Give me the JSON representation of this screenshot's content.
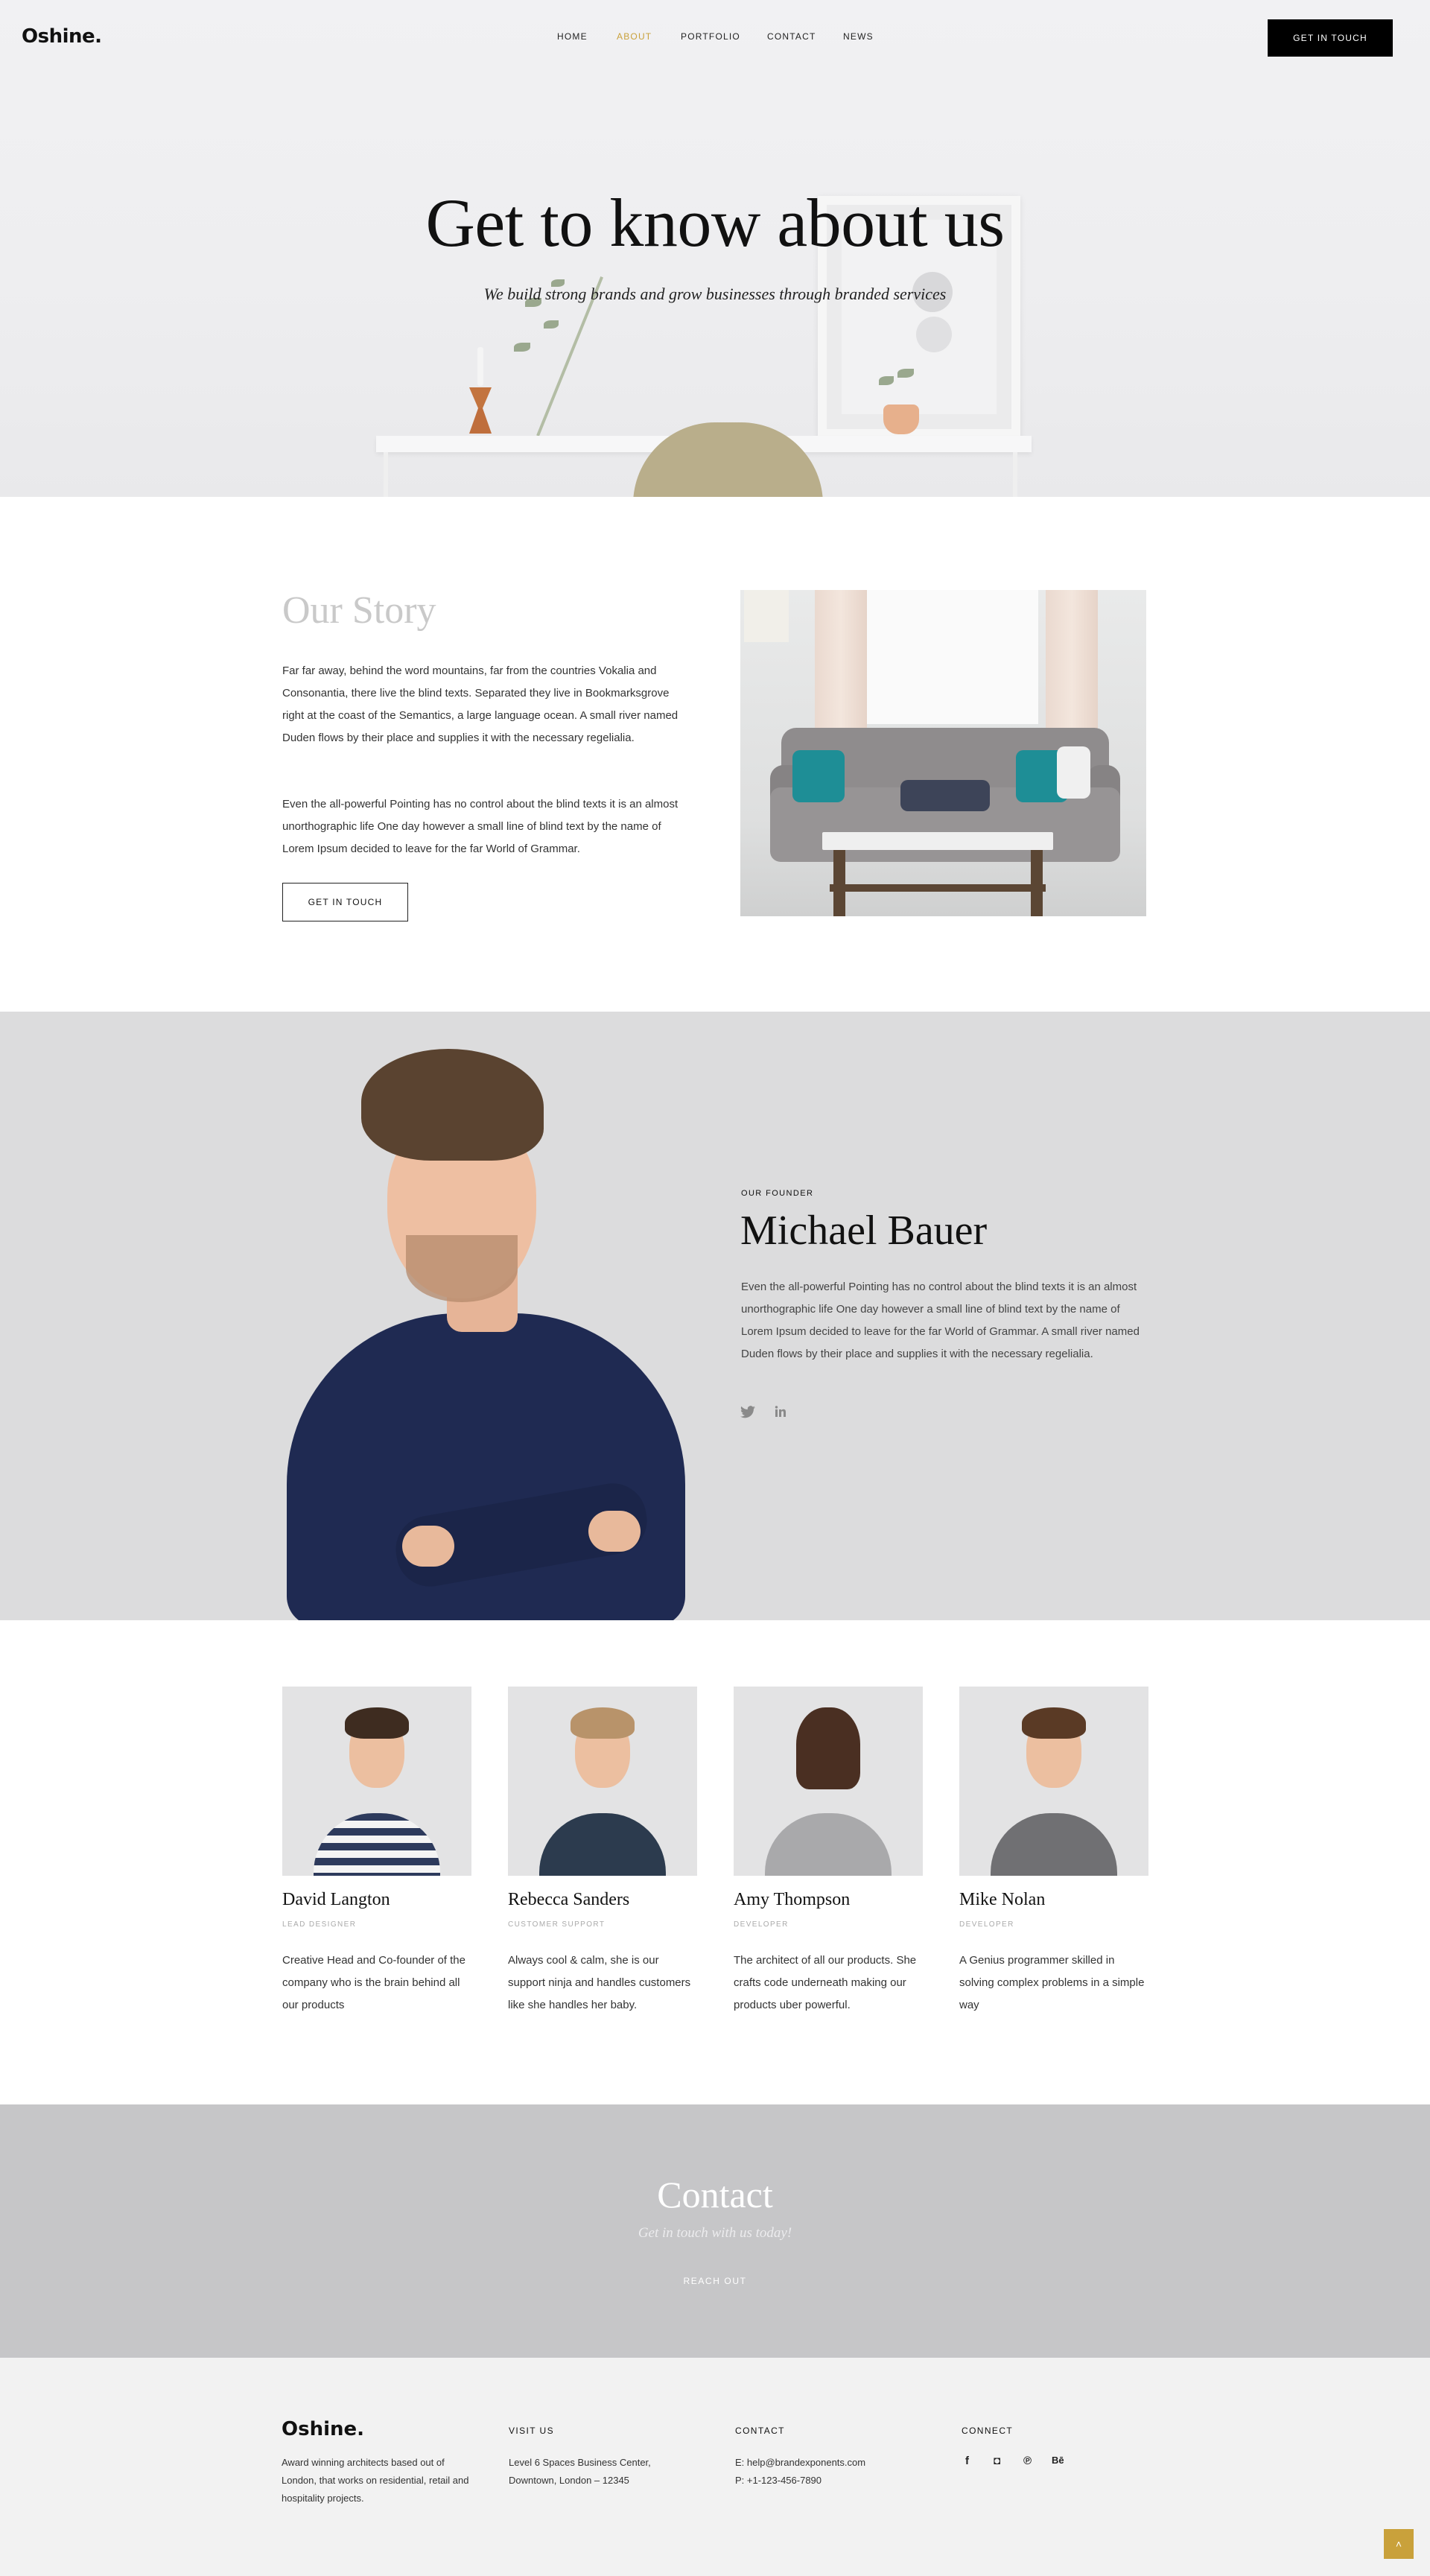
{
  "header": {
    "logo": "Oshine.",
    "nav": [
      "HOME",
      "ABOUT",
      "PORTFOLIO",
      "CONTACT",
      "NEWS"
    ],
    "active_nav": "ABOUT",
    "cta": "GET IN TOUCH"
  },
  "hero": {
    "title": "Get to know about us",
    "subtitle": "We build strong brands and grow businesses through branded services"
  },
  "story": {
    "heading": "Our Story",
    "paragraph1": "Far far away, behind the word mountains, far from the countries Vokalia and Consonantia, there live the blind texts. Separated they live in Bookmarksgrove right at the coast of the Semantics, a large language ocean. A small river named Duden flows by their place and supplies it with the necessary regelialia.",
    "paragraph2": "Even the all-powerful Pointing has no control about the blind texts it is an almost unorthographic life One day however a small line of blind text by the name of Lorem Ipsum decided to leave for the far World of Grammar.",
    "button": "GET IN TOUCH"
  },
  "founder": {
    "kicker": "OUR FOUNDER",
    "name": "Michael Bauer",
    "bio": "Even the all-powerful Pointing has no control about the blind texts it is an almost unorthographic life One day however a small line of blind text by the name of Lorem Ipsum decided to leave for the far World of Grammar. A small river named Duden flows by their place and supplies it with the necessary regelialia.",
    "social": [
      "twitter-icon",
      "linkedin-icon"
    ]
  },
  "team": [
    {
      "name": "David Langton",
      "role": "LEAD DESIGNER",
      "desc": "Creative Head and Co-founder of the company who is the brain behind all our products"
    },
    {
      "name": "Rebecca Sanders",
      "role": "CUSTOMER SUPPORT",
      "desc": "Always cool & calm, she is our support ninja and handles customers like she handles her baby."
    },
    {
      "name": "Amy Thompson",
      "role": "DEVELOPER",
      "desc": "The architect of all our products. She crafts code underneath making our products uber powerful."
    },
    {
      "name": "Mike Nolan",
      "role": "DEVELOPER",
      "desc": "A Genius programmer skilled in solving complex problems in a simple way"
    }
  ],
  "contact": {
    "heading": "Contact",
    "subtitle": "Get in touch with us today!",
    "button": "REACH OUT"
  },
  "footer": {
    "logo": "Oshine.",
    "about": "Award winning architects based out of London, that works on residential, retail and hospitality projects.",
    "visit_heading": "VISIT US",
    "address": "Level 6 Spaces Business Center, Downtown, London – 12345",
    "contact_heading": "CONTACT",
    "email": "E: help@brandexponents.com",
    "phone": "P: +1-123-456-7890",
    "connect_heading": "CONNECT",
    "social_glyphs": [
      "f",
      "◘",
      "℗",
      "Bē"
    ],
    "social_icons": [
      "facebook-icon",
      "instagram-icon",
      "pinterest-icon",
      "behance-icon"
    ]
  },
  "colors": {
    "accent": "#c9a13b",
    "founder_bg": "#dcdcdd",
    "contact_bg": "#c6c6c8",
    "footer_bg": "#f2f2f2"
  },
  "back_to_top_glyph": "˄"
}
